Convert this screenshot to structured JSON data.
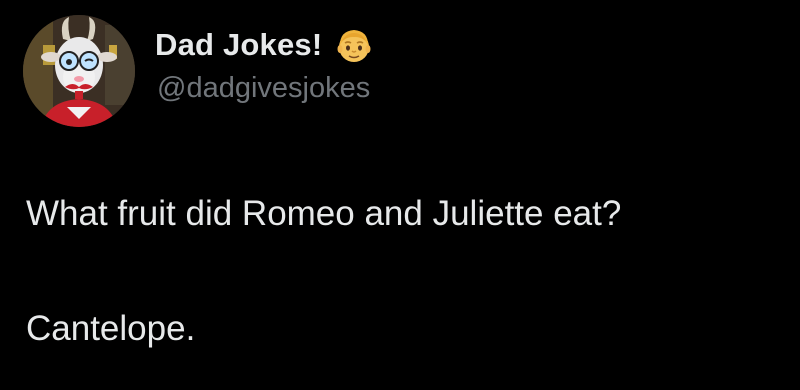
{
  "author": {
    "display_name": "Dad Jokes!",
    "handle": "@dadgivesjokes",
    "badge_icon": "man-emoji-icon",
    "avatar_icon": "goat-dad-avatar"
  },
  "tweet": {
    "lines": [
      "What fruit did Romeo and Juliette eat?",
      "Cantelope."
    ]
  },
  "colors": {
    "background": "#000000",
    "primary_text": "#e7e9ea",
    "secondary_text": "#71767b"
  }
}
